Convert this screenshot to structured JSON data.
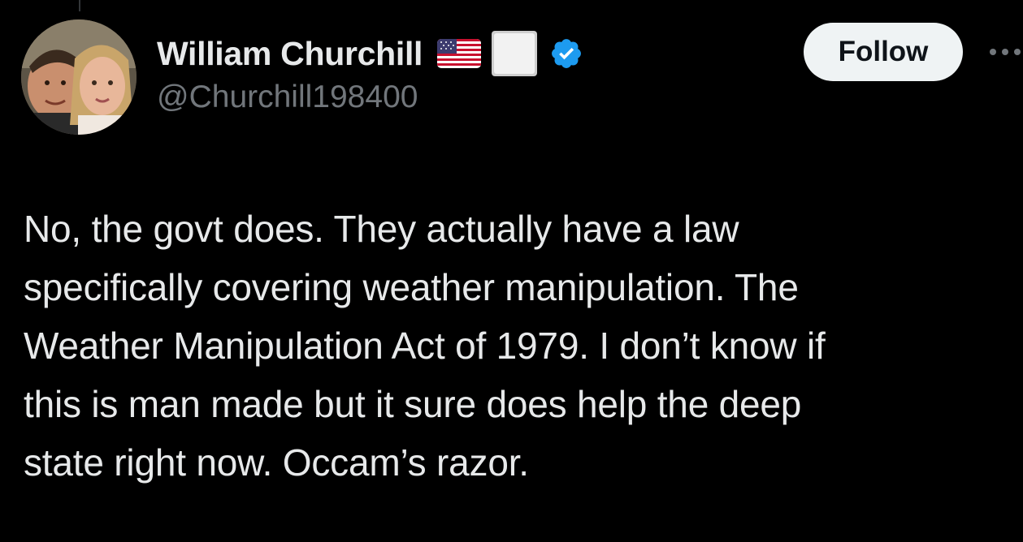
{
  "author": {
    "display_name": "William Churchill",
    "handle": "@Churchill198400",
    "badges": [
      "us-flag-emoji",
      "white-square-emoji",
      "verified-badge"
    ],
    "verified_color": "#1d9bf0"
  },
  "actions": {
    "follow_label": "Follow",
    "more_icon": "ellipsis-horizontal"
  },
  "tweet": {
    "lines": [
      "No, the govt does. They actually have a law",
      "specifically covering weather manipulation. The",
      "Weather Manipulation Act of 1979. I don’t know if",
      "this is man made but it sure does help the deep",
      "state right now. Occam’s razor."
    ]
  },
  "theme": {
    "background": "#000000",
    "text": "#e7e9ea",
    "secondary_text": "#71767b",
    "button_bg": "#eff3f4"
  }
}
